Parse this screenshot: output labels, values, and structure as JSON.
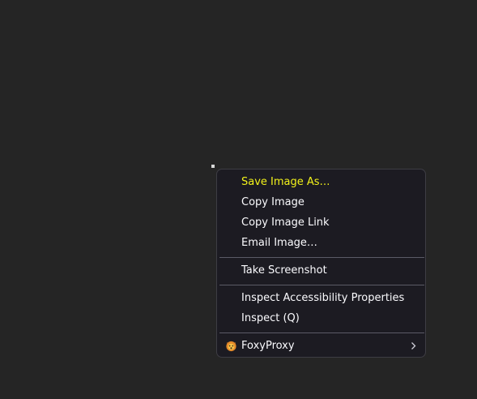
{
  "context_menu": {
    "items": [
      {
        "label": "Save Image As…"
      },
      {
        "label": "Copy Image"
      },
      {
        "label": "Copy Image Link"
      },
      {
        "label": "Email Image…"
      },
      {
        "label": "Take Screenshot"
      },
      {
        "label": "Inspect Accessibility Properties"
      },
      {
        "label": "Inspect (Q)"
      },
      {
        "label": "FoxyProxy"
      }
    ]
  },
  "colors": {
    "desktop_background": "#252525",
    "menu_background": "#1c1b22",
    "menu_text": "#fbfbfe",
    "highlight_text": "#f2f21a",
    "separator": "#5b5b66"
  },
  "icons": {
    "foxyproxy": "foxyproxy-icon",
    "submenu": "chevron-right-icon"
  }
}
